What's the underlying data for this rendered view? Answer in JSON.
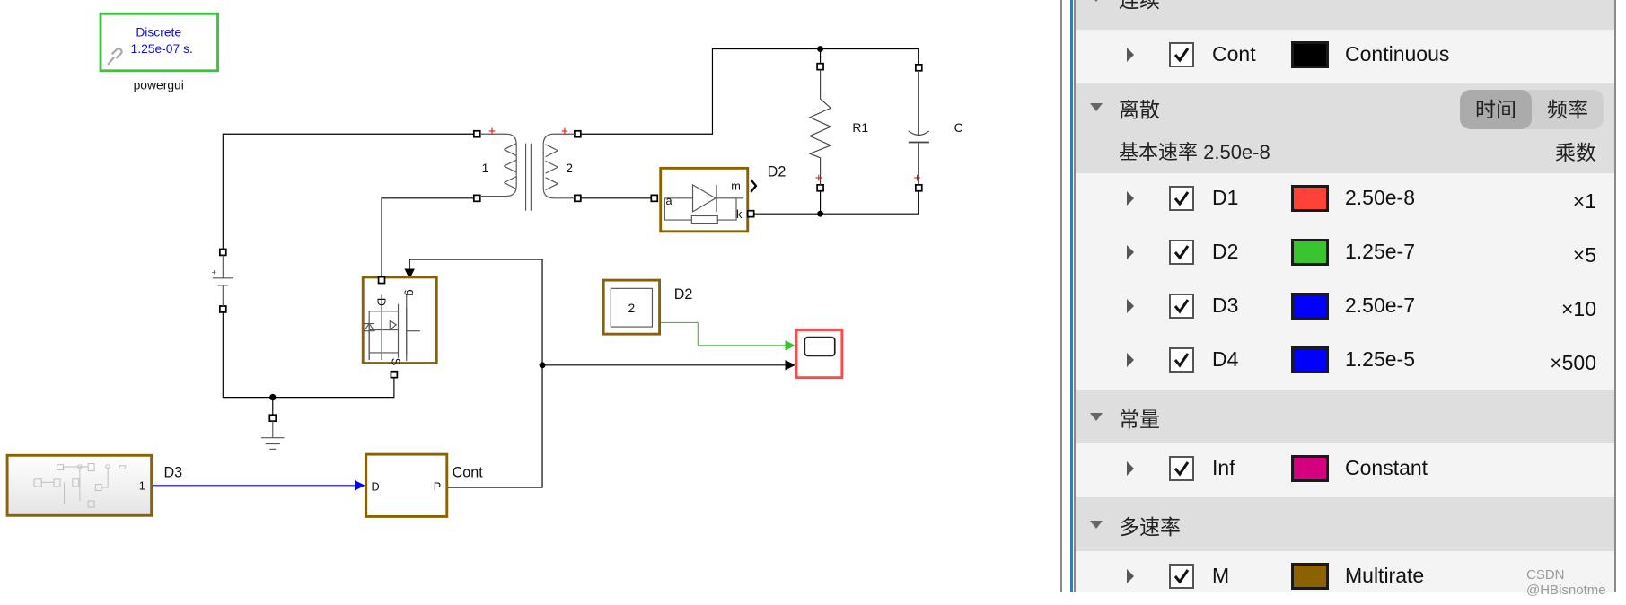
{
  "diagram": {
    "powergui": {
      "line1": "Discrete",
      "line2": "1.25e-07 s.",
      "label": "powergui"
    },
    "transformer": {
      "winding1": "1",
      "winding2": "2"
    },
    "resistor": {
      "label": "R1"
    },
    "capacitor": {
      "label": "C"
    },
    "diode": {
      "label": "D2",
      "port_a": "a",
      "port_k": "k",
      "port_m": "m"
    },
    "mosfet": {
      "port_d": "D",
      "port_g": "g",
      "port_s": "S"
    },
    "constant": {
      "value": "2",
      "signal_label": "D2"
    },
    "subsystem": {
      "port": "1",
      "signal_label": "D3"
    },
    "pwm": {
      "port_in": "D",
      "port_out": "P",
      "signal_label": "Cont"
    }
  },
  "legend": {
    "groups": [
      {
        "title": "连续",
        "rows": [
          {
            "label": "Cont",
            "color": "#000000",
            "desc": "Continuous",
            "mult": "",
            "checked": true
          }
        ]
      },
      {
        "title": "离散",
        "toggle": {
          "time": "时间",
          "freq": "频率",
          "active": "time"
        },
        "base_rate": "基本速率 2.50e-8",
        "mult_header": "乘数",
        "rows": [
          {
            "label": "D1",
            "color": "#ff4238",
            "desc": "2.50e-8",
            "mult": "×1",
            "checked": true
          },
          {
            "label": "D2",
            "color": "#38c530",
            "desc": "1.25e-7",
            "mult": "×5",
            "checked": true
          },
          {
            "label": "D3",
            "color": "#0000ff",
            "desc": "2.50e-7",
            "mult": "×10",
            "checked": true
          },
          {
            "label": "D4",
            "color": "#0000ff",
            "desc": "1.25e-5",
            "mult": "×500",
            "checked": true
          }
        ]
      },
      {
        "title": "常量",
        "rows": [
          {
            "label": "Inf",
            "color": "#d5007f",
            "desc": "Constant",
            "mult": "",
            "checked": true
          }
        ]
      },
      {
        "title": "多速率",
        "rows": [
          {
            "label": "M",
            "color": "#8a6300",
            "desc": "Multirate",
            "mult": "",
            "checked": true
          }
        ]
      }
    ]
  },
  "watermark": "CSDN @HBisnotme"
}
